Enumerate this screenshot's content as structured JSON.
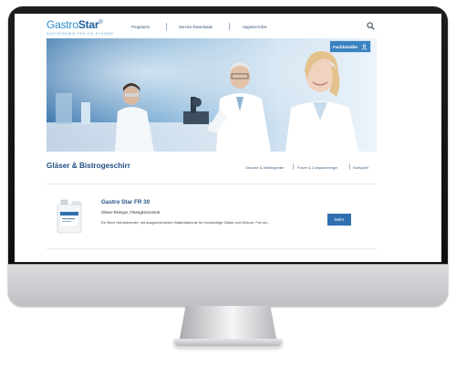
{
  "brand": {
    "name_light": "Gastro",
    "name_bold": "Star",
    "mark": "®",
    "tagline": "GASTRONOMIE FÜR DIE HYGIENE"
  },
  "nav": {
    "items": [
      {
        "label": "Programm"
      },
      {
        "label": "Service-Downloads"
      },
      {
        "label": "Hygiene-Infos"
      }
    ],
    "search_icon": "search-icon"
  },
  "hero": {
    "badge_label": "Fachhändler",
    "badge_icon": "user-icon"
  },
  "category": {
    "title": "Gläser & Bistrogeschirr",
    "links": [
      {
        "label": "Geschirr & Arbeitsgeräte"
      },
      {
        "label": "Pulver & Compactreiniger"
      },
      {
        "label": "Klarspüler"
      }
    ]
  },
  "product": {
    "name": "Gastro Star FR 30",
    "subtitle": "Gläser-Reiniger, Flüssigkonzentrat",
    "description": "Ein flinnt Getränkereste, mit ausgezeichnetem Materialschutz für hochwertige Gläser und Dekore. Frei wo...",
    "more_label": "Mehr"
  },
  "colors": {
    "brand_blue": "#1d5f9b",
    "accent_blue": "#2f6fb0",
    "badge_blue": "#3b82c0"
  }
}
